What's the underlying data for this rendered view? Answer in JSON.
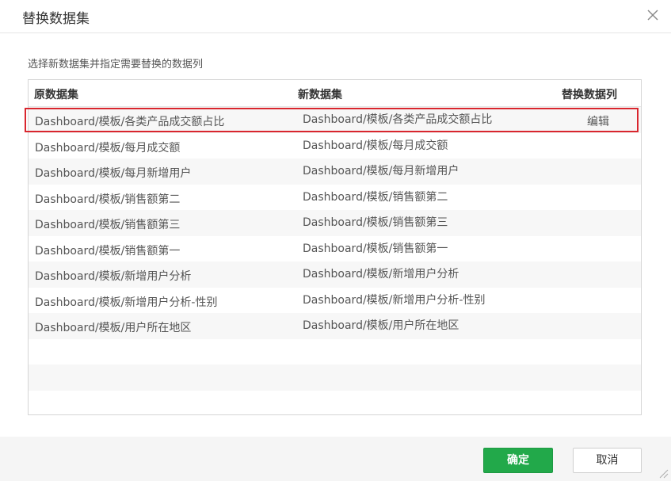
{
  "dialog": {
    "title": "替换数据集",
    "instruction": "选择新数据集并指定需要替换的数据列"
  },
  "table": {
    "headers": {
      "original": "原数据集",
      "new": "新数据集",
      "replace_columns": "替换数据列"
    },
    "rows": [
      {
        "original": "Dashboard/模板/各类产品成交额占比",
        "new": "Dashboard/模板/各类产品成交额占比",
        "action": "编辑"
      },
      {
        "original": "Dashboard/模板/每月成交额",
        "new": "Dashboard/模板/每月成交额",
        "action": ""
      },
      {
        "original": "Dashboard/模板/每月新增用户",
        "new": "Dashboard/模板/每月新增用户",
        "action": ""
      },
      {
        "original": "Dashboard/模板/销售额第二",
        "new": "Dashboard/模板/销售额第二",
        "action": ""
      },
      {
        "original": "Dashboard/模板/销售额第三",
        "new": "Dashboard/模板/销售额第三",
        "action": ""
      },
      {
        "original": "Dashboard/模板/销售额第一",
        "new": "Dashboard/模板/销售额第一",
        "action": ""
      },
      {
        "original": "Dashboard/模板/新增用户分析",
        "new": "Dashboard/模板/新增用户分析",
        "action": ""
      },
      {
        "original": "Dashboard/模板/新增用户分析-性别",
        "new": "Dashboard/模板/新增用户分析-性别",
        "action": ""
      },
      {
        "original": "Dashboard/模板/用户所在地区",
        "new": "Dashboard/模板/用户所在地区",
        "action": ""
      },
      {
        "original": "",
        "new": "",
        "action": ""
      },
      {
        "original": "",
        "new": "",
        "action": ""
      },
      {
        "original": "",
        "new": "",
        "action": ""
      }
    ]
  },
  "footer": {
    "ok_label": "确定",
    "cancel_label": "取消"
  },
  "colors": {
    "ok_button": "#22a94a",
    "highlight": "#d9262e"
  }
}
